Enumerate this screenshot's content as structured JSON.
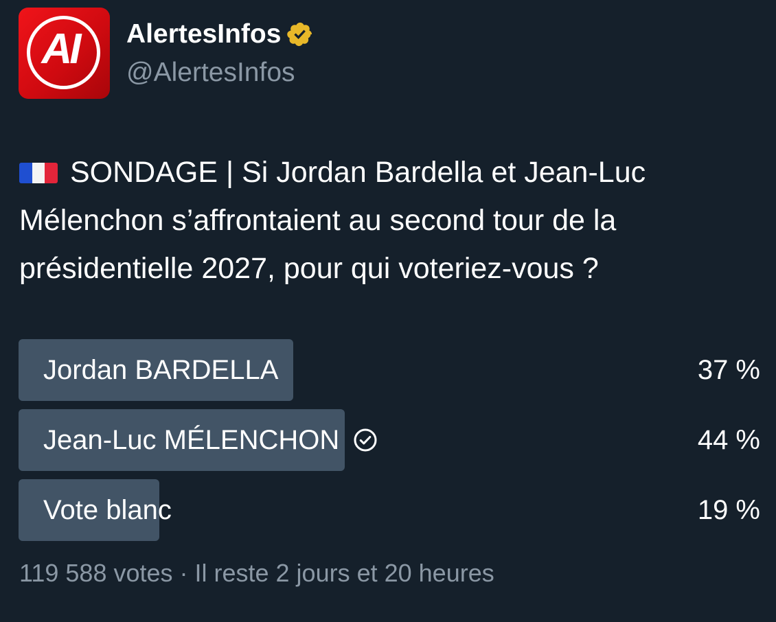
{
  "account": {
    "display_name": "AlertesInfos",
    "handle": "@AlertesInfos",
    "avatar_monogram": "AI",
    "verified_icon": "verified-badge-gold"
  },
  "tweet": {
    "flag_icon": "france-flag",
    "text": "SONDAGE | Si Jordan Bardella et Jean-Luc Mélenchon s’affrontaient au second tour de la présidentielle 2027, pour qui voteriez-vous ?"
  },
  "poll": {
    "options": [
      {
        "label": "Jordan BARDELLA",
        "percent_label": "37 %",
        "fraction": 0.37,
        "selected": false
      },
      {
        "label": "Jean-Luc MÉLENCHON",
        "percent_label": "44 %",
        "fraction": 0.44,
        "selected": true
      },
      {
        "label": "Vote blanc",
        "percent_label": "19 %",
        "fraction": 0.19,
        "selected": false
      }
    ],
    "footer": "119 588 votes · Il reste 2 jours et 20 heures"
  },
  "colors": {
    "background": "#15202b",
    "poll_bar": "#425466",
    "secondary_text": "#8b98a5",
    "brand_red": "#e0141a",
    "verified_gold": "#e8b829"
  }
}
